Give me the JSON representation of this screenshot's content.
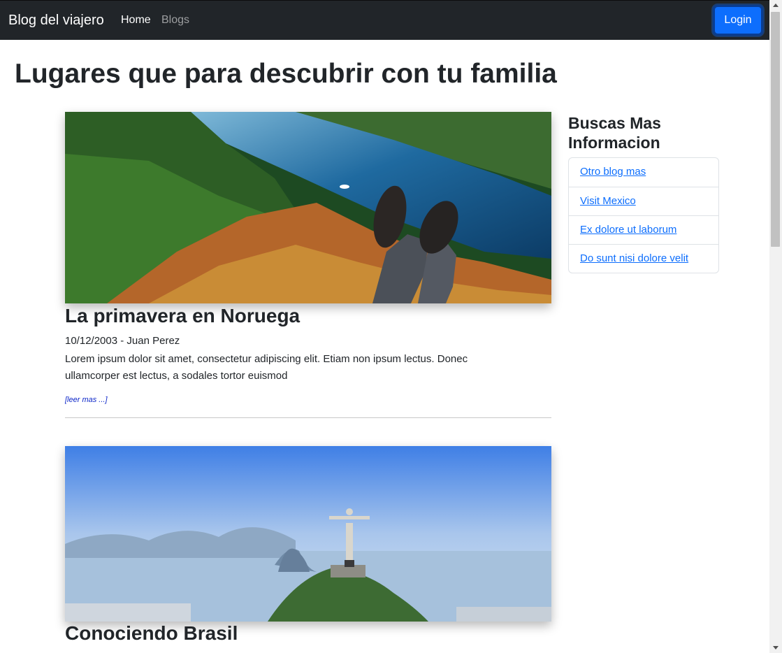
{
  "navbar": {
    "brand": "Blog del viajero",
    "links": [
      {
        "label": "Home"
      },
      {
        "label": "Blogs"
      }
    ],
    "login_label": "Login"
  },
  "page": {
    "title": "Lugares que para descubrir con tu familia"
  },
  "posts": [
    {
      "title": "La primavera en Noruega",
      "meta": "10/12/2003 - Juan Perez",
      "excerpt": "Lorem ipsum dolor sit amet, consectetur adipiscing elit. Etiam non ipsum lectus. Donec ullamcorper est lectus, a sodales tortor euismod",
      "read_more": "[leer mas ...]"
    },
    {
      "title": "Conociendo Brasil"
    }
  ],
  "sidebar": {
    "title": "Buscas Mas Informacion",
    "links": [
      {
        "label": "Otro blog mas"
      },
      {
        "label": "Visit Mexico"
      },
      {
        "label": "Ex dolore ut laborum"
      },
      {
        "label": "Do sunt nisi dolore velit"
      }
    ]
  },
  "colors": {
    "navbar_bg": "#212529",
    "primary": "#0d6efd",
    "read_more": "#0d27c9"
  }
}
